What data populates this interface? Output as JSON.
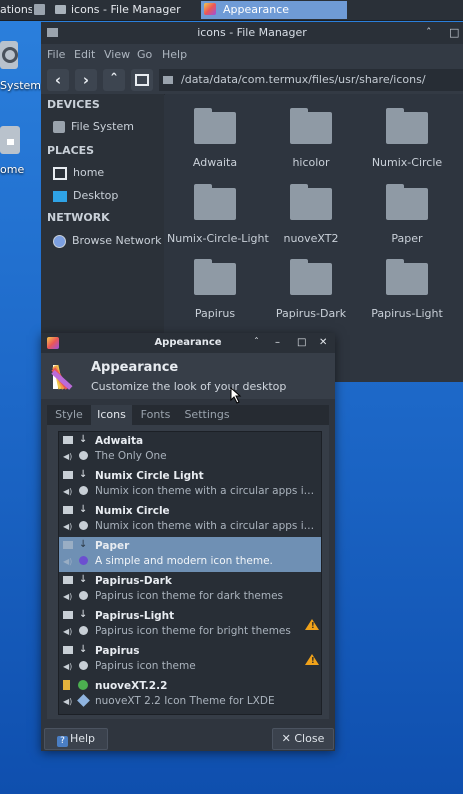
{
  "taskbar": {
    "items": [
      {
        "label": "ations"
      },
      {
        "label": "icons - File Manager"
      },
      {
        "label": "Appearance"
      }
    ]
  },
  "desktop": {
    "icons": [
      {
        "label": "System",
        "icon": "system-icon"
      },
      {
        "label": "ome",
        "icon": "home-folder-icon"
      }
    ]
  },
  "file_manager": {
    "title": "icons - File Manager",
    "menu": [
      "File",
      "Edit",
      "View",
      "Go",
      "Help"
    ],
    "path": "/data/data/com.termux/files/usr/share/icons/",
    "sidebar": {
      "devices_heading": "DEVICES",
      "devices": [
        {
          "label": "File System",
          "icon": "drive-icon"
        }
      ],
      "places_heading": "PLACES",
      "places": [
        {
          "label": "home",
          "icon": "home-icon"
        },
        {
          "label": "Desktop",
          "icon": "desktop-icon"
        }
      ],
      "network_heading": "NETWORK",
      "network": [
        {
          "label": "Browse Network",
          "icon": "globe-icon"
        }
      ]
    },
    "folders": [
      "Adwaita",
      "hicolor",
      "Numix-Circle",
      "Numix-Circle-Light",
      "nuoveXT2",
      "Paper",
      "Papirus",
      "Papirus-Dark",
      "Papirus-Light"
    ]
  },
  "appearance": {
    "window_title": "Appearance",
    "header_title": "Appearance",
    "header_subtitle": "Customize the look of your desktop",
    "tabs": [
      "Style",
      "Icons",
      "Fonts",
      "Settings"
    ],
    "selected_tab": "Icons",
    "themes": [
      {
        "name": "Adwaita",
        "desc": "The Only One",
        "warning": false,
        "selected": false
      },
      {
        "name": "Numix Circle Light",
        "desc": "Numix icon theme with a circular apps icons d…",
        "warning": false,
        "selected": false
      },
      {
        "name": "Numix Circle",
        "desc": "Numix icon theme with a circular apps icons d…",
        "warning": false,
        "selected": false
      },
      {
        "name": "Paper",
        "desc": "A simple and modern icon theme.",
        "warning": false,
        "selected": true
      },
      {
        "name": "Papirus-Dark",
        "desc": "Papirus icon theme for dark themes",
        "warning": false,
        "selected": false
      },
      {
        "name": "Papirus-Light",
        "desc": "Papirus icon theme for bright themes",
        "warning": true,
        "selected": false
      },
      {
        "name": "Papirus",
        "desc": "Papirus icon theme",
        "warning": true,
        "selected": false
      },
      {
        "name": "nuoveXT.2.2",
        "desc": "nuoveXT 2.2 Icon Theme for LXDE",
        "warning": false,
        "selected": false
      }
    ],
    "help_label": "Help",
    "close_label": "Close",
    "colors": {
      "selection": "#6f90b4",
      "warning": "#f0a21a",
      "accent": "#6f9bd6"
    }
  }
}
